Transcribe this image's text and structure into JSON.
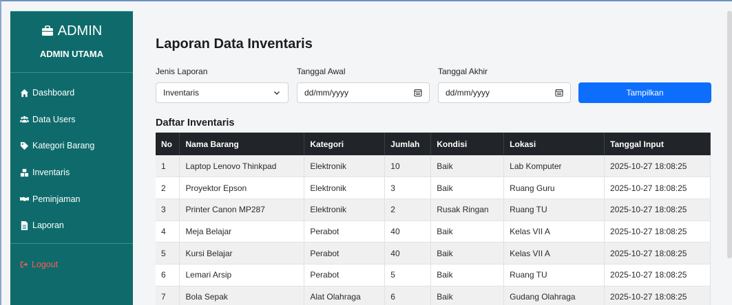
{
  "sidebar": {
    "brand_title": "ADMIN",
    "brand_sub": "ADMIN UTAMA",
    "items": [
      {
        "label": "Dashboard",
        "icon": "home-icon"
      },
      {
        "label": "Data Users",
        "icon": "users-icon"
      },
      {
        "label": "Kategori Barang",
        "icon": "tag-icon"
      },
      {
        "label": "Inventaris",
        "icon": "boxes-icon"
      },
      {
        "label": "Peminjaman",
        "icon": "handshake-icon"
      },
      {
        "label": "Laporan",
        "icon": "file-icon"
      }
    ],
    "logout": "Logout"
  },
  "main": {
    "page_title": "Laporan Data Inventaris",
    "filters": {
      "jenis_label": "Jenis Laporan",
      "jenis_value": "Inventaris",
      "awal_label": "Tanggal Awal",
      "awal_placeholder": "dd/mm/yyyy",
      "akhir_label": "Tanggal Akhir",
      "akhir_placeholder": "dd/mm/yyyy",
      "submit": "Tampilkan"
    },
    "section_title": "Daftar Inventaris",
    "table": {
      "headers": [
        "No",
        "Nama Barang",
        "Kategori",
        "Jumlah",
        "Kondisi",
        "Lokasi",
        "Tanggal Input"
      ],
      "rows": [
        [
          "1",
          "Laptop Lenovo Thinkpad",
          "Elektronik",
          "10",
          "Baik",
          "Lab Komputer",
          "2025-10-27 18:08:25"
        ],
        [
          "2",
          "Proyektor Epson",
          "Elektronik",
          "3",
          "Baik",
          "Ruang Guru",
          "2025-10-27 18:08:25"
        ],
        [
          "3",
          "Printer Canon MP287",
          "Elektronik",
          "2",
          "Rusak Ringan",
          "Ruang TU",
          "2025-10-27 18:08:25"
        ],
        [
          "4",
          "Meja Belajar",
          "Perabot",
          "40",
          "Baik",
          "Kelas VII A",
          "2025-10-27 18:08:25"
        ],
        [
          "5",
          "Kursi Belajar",
          "Perabot",
          "40",
          "Baik",
          "Kelas VII A",
          "2025-10-27 18:08:25"
        ],
        [
          "6",
          "Lemari Arsip",
          "Perabot",
          "5",
          "Baik",
          "Ruang TU",
          "2025-10-27 18:08:25"
        ],
        [
          "7",
          "Bola Sepak",
          "Alat Olahraga",
          "6",
          "Baik",
          "Gudang Olahraga",
          "2025-10-27 18:08:25"
        ]
      ]
    }
  },
  "colors": {
    "sidebar_bg": "#0f6b6b",
    "accent": "#0d6efd",
    "table_header": "#212529",
    "logout": "#ff5a5a"
  }
}
